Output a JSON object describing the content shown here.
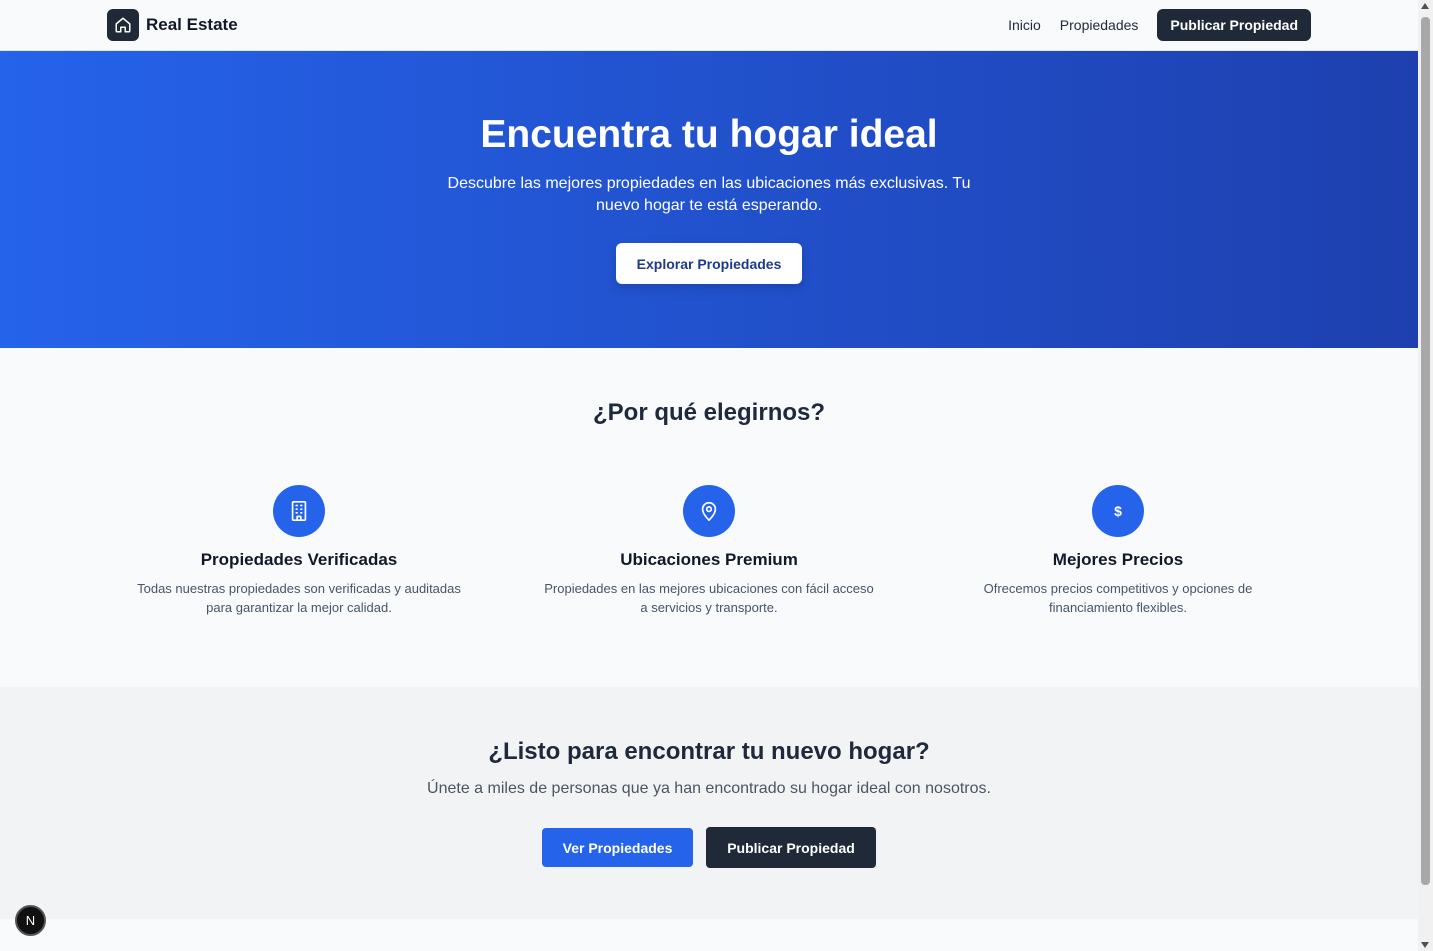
{
  "header": {
    "brand": "Real Estate",
    "nav": {
      "home": "Inicio",
      "properties": "Propiedades",
      "publish": "Publicar Propiedad"
    }
  },
  "hero": {
    "title": "Encuentra tu hogar ideal",
    "subtitle": "Descubre las mejores propiedades en las ubicaciones más exclusivas. Tu nuevo hogar te está esperando.",
    "cta": "Explorar Propiedades"
  },
  "features": {
    "title": "¿Por qué elegirnos?",
    "items": [
      {
        "icon": "building-icon",
        "title": "Propiedades Verificadas",
        "description": "Todas nuestras propiedades son verificadas y auditadas para garantizar la mejor calidad."
      },
      {
        "icon": "location-pin-icon",
        "title": "Ubicaciones Premium",
        "description": "Propiedades en las mejores ubicaciones con fácil acceso a servicios y transporte."
      },
      {
        "icon": "dollar-icon",
        "glyph": "$",
        "title": "Mejores Precios",
        "description": "Ofrecemos precios competitivos y opciones de financiamiento flexibles."
      }
    ]
  },
  "cta": {
    "title": "¿Listo para encontrar tu nuevo hogar?",
    "subtitle": "Únete a miles de personas que ya han encontrado su hogar ideal con nosotros.",
    "primary": "Ver Propiedades",
    "secondary": "Publicar Propiedad"
  },
  "dev_indicator": {
    "label": "N"
  },
  "colors": {
    "accent": "#2563eb",
    "dark": "#1f2937",
    "hero_start": "#2563eb",
    "hero_end": "#1e40af"
  }
}
